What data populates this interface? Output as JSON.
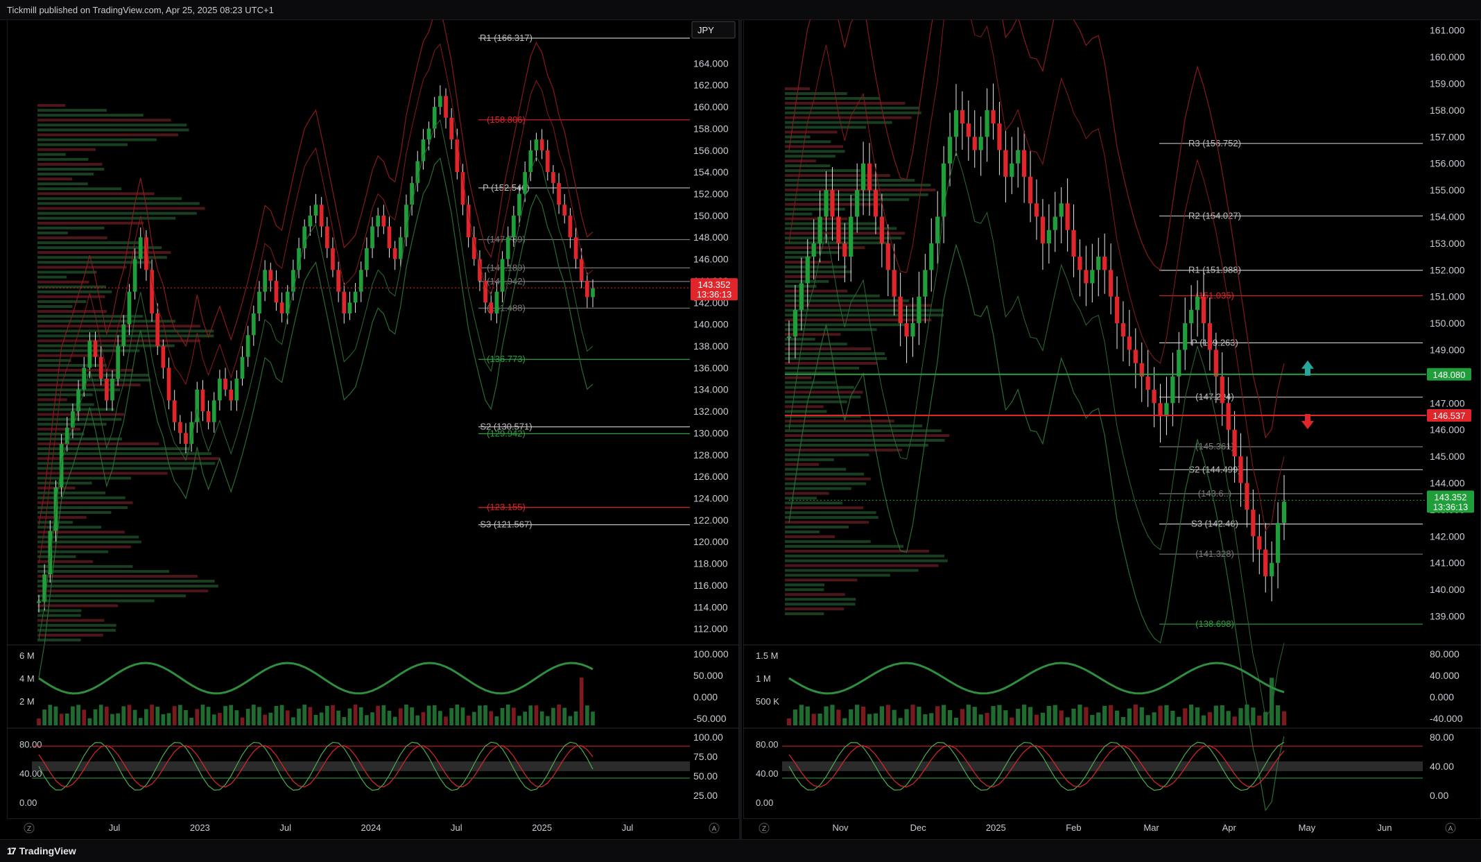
{
  "header": {
    "publisher": "Tickmill published on TradingView.com, Apr 25, 2025 08:23 UTC+1"
  },
  "footer": {
    "brand": "TradingView"
  },
  "colors": {
    "up": "#1f9e3a",
    "down": "#e0262b",
    "pivot": "#bfbfbf",
    "background": "#000000"
  },
  "chart_data": [
    {
      "type": "candlestick",
      "title": "",
      "symbol_badge": "JPY",
      "timeframe": "weekly",
      "ylim": [
        110,
        166
      ],
      "price_ticks": [
        "164.000",
        "162.000",
        "160.000",
        "158.000",
        "156.000",
        "154.000",
        "152.000",
        "150.000",
        "148.000",
        "146.000",
        "144.000",
        "142.000",
        "140.000",
        "138.000",
        "136.000",
        "134.000",
        "132.000",
        "130.000",
        "128.000",
        "126.000",
        "124.000",
        "122.000",
        "120.000",
        "118.000",
        "116.000",
        "114.000",
        "112.000"
      ],
      "x_labels": [
        "Jul",
        "2023",
        "Jul",
        "2024",
        "Jul",
        "2025",
        "Jul"
      ],
      "last_price": "143.352",
      "countdown": "13:36:13",
      "levels": [
        {
          "label": "R1 (166.317)",
          "value": 166.317,
          "kind": "pivot"
        },
        {
          "label": "(158.806)",
          "value": 158.806,
          "kind": "red"
        },
        {
          "label": "P (152.546)",
          "value": 152.546,
          "kind": "pivot"
        },
        {
          "label": "(147.789)",
          "value": 147.789,
          "kind": "grey"
        },
        {
          "label": "(145.189)",
          "value": 145.189,
          "kind": "grey"
        },
        {
          "label": "(143.942)",
          "value": 143.942,
          "kind": "grey"
        },
        {
          "label": "(141.488)",
          "value": 141.488,
          "kind": "grey"
        },
        {
          "label": "(136.773)",
          "value": 136.773,
          "kind": "green"
        },
        {
          "label": "S2 (130.571)",
          "value": 130.571,
          "kind": "pivot"
        },
        {
          "label": "(129.942)",
          "value": 129.942,
          "kind": "green"
        },
        {
          "label": "(123.155)",
          "value": 123.155,
          "kind": "red"
        },
        {
          "label": "S3 (121.567)",
          "value": 121.567,
          "kind": "pivot"
        }
      ],
      "series": [
        {
          "name": "",
          "values": [
            114.5,
            117,
            121,
            125,
            129,
            130.5,
            132,
            134,
            136,
            138.5,
            137,
            135,
            133,
            135,
            138,
            140,
            143,
            146,
            148,
            145,
            141,
            138,
            136,
            133,
            131,
            130,
            129,
            131,
            134,
            132,
            131,
            133,
            135,
            134,
            133,
            135,
            137,
            139,
            141,
            143,
            145,
            144,
            142,
            141,
            143,
            145,
            147,
            149,
            150,
            151,
            149,
            147,
            145,
            143,
            141,
            142,
            143,
            145,
            147,
            149,
            150,
            149,
            147,
            146,
            148,
            151,
            153,
            155,
            157,
            158,
            160,
            161,
            159,
            157,
            154,
            151,
            148,
            146,
            144,
            142,
            141,
            143,
            146,
            148,
            150,
            152,
            154,
            156,
            157,
            156,
            154,
            153,
            151,
            150,
            148,
            146,
            144,
            142.5,
            143.3
          ]
        }
      ],
      "indicators": [
        {
          "label": "volume",
          "ticks": [
            "6 M",
            "4 M",
            "2 M"
          ],
          "right_ticks": [
            "100.000",
            "50.000",
            "0.000",
            "-50.000"
          ]
        },
        {
          "label": "stochastic",
          "ticks": [
            "80.00",
            "40.00",
            "0.00"
          ],
          "right_ticks": [
            "100.00",
            "75.00",
            "50.00",
            "25.00"
          ]
        }
      ]
    },
    {
      "type": "candlestick",
      "title": "",
      "timeframe": "daily",
      "ylim": [
        138.7,
        161.2
      ],
      "price_ticks": [
        "161.000",
        "160.000",
        "159.000",
        "158.000",
        "157.000",
        "156.000",
        "155.000",
        "154.000",
        "153.000",
        "152.000",
        "151.000",
        "150.000",
        "149.000",
        "148.000",
        "147.000",
        "146.000",
        "145.000",
        "144.000",
        "143.000",
        "142.000",
        "141.000",
        "140.000",
        "139.000"
      ],
      "x_labels": [
        "Nov",
        "Dec",
        "2025",
        "Feb",
        "Mar",
        "Apr",
        "May",
        "Jun"
      ],
      "last_price": "143.352",
      "countdown": "13:36:13",
      "marker_up": "148.080",
      "marker_down": "146.537",
      "levels": [
        {
          "label": "R3 (156.752)",
          "value": 156.752,
          "kind": "pivot"
        },
        {
          "label": "R2 (154.027)",
          "value": 154.027,
          "kind": "pivot"
        },
        {
          "label": "R1 (151.988)",
          "value": 151.988,
          "kind": "pivot"
        },
        {
          "label": "(151.035)",
          "value": 151.035,
          "kind": "red"
        },
        {
          "label": "P (149.263)",
          "value": 149.263,
          "kind": "pivot"
        },
        {
          "label": "(147.224)",
          "value": 147.224,
          "kind": "pivot"
        },
        {
          "label": "(145.361)",
          "value": 145.361,
          "kind": "grey"
        },
        {
          "label": "S2 (144.499)",
          "value": 144.499,
          "kind": "pivot"
        },
        {
          "label": "(143.6..)",
          "value": 143.6,
          "kind": "grey"
        },
        {
          "label": "S3 (142.46)",
          "value": 142.46,
          "kind": "pivot"
        },
        {
          "label": "(141.328)",
          "value": 141.328,
          "kind": "grey"
        },
        {
          "label": "(138.698)",
          "value": 138.698,
          "kind": "green"
        }
      ],
      "series": [
        {
          "name": "",
          "values": [
            149.5,
            150.5,
            151.5,
            152.5,
            153,
            154,
            155,
            154,
            153,
            152.5,
            154,
            155,
            156,
            155,
            154,
            153,
            152,
            151,
            150,
            149.5,
            150,
            151,
            152,
            153,
            154,
            156,
            157,
            158,
            157.5,
            157,
            156.5,
            157,
            158,
            157.5,
            156.5,
            155.5,
            156,
            156.5,
            155.5,
            154.5,
            154,
            153,
            153.5,
            154,
            154.5,
            153.5,
            152.5,
            152,
            151.5,
            152,
            152.5,
            152,
            151,
            150,
            149.5,
            149,
            148.5,
            148,
            147.5,
            147,
            146.5,
            147,
            148,
            149,
            150,
            150.5,
            151,
            150,
            149,
            148,
            147,
            146,
            145,
            144,
            143,
            142,
            141.5,
            140.5,
            141,
            142.5,
            143.3
          ]
        }
      ],
      "indicators": [
        {
          "label": "volume",
          "ticks": [
            "1.5 M",
            "1 M",
            "500 K"
          ],
          "right_ticks": [
            "80.000",
            "40.000",
            "0.000",
            "-40.000"
          ]
        },
        {
          "label": "stochastic",
          "ticks": [
            "80.00",
            "40.00",
            "0.00"
          ],
          "right_ticks": [
            "80.00",
            "40.00",
            "0.00"
          ]
        }
      ]
    }
  ]
}
